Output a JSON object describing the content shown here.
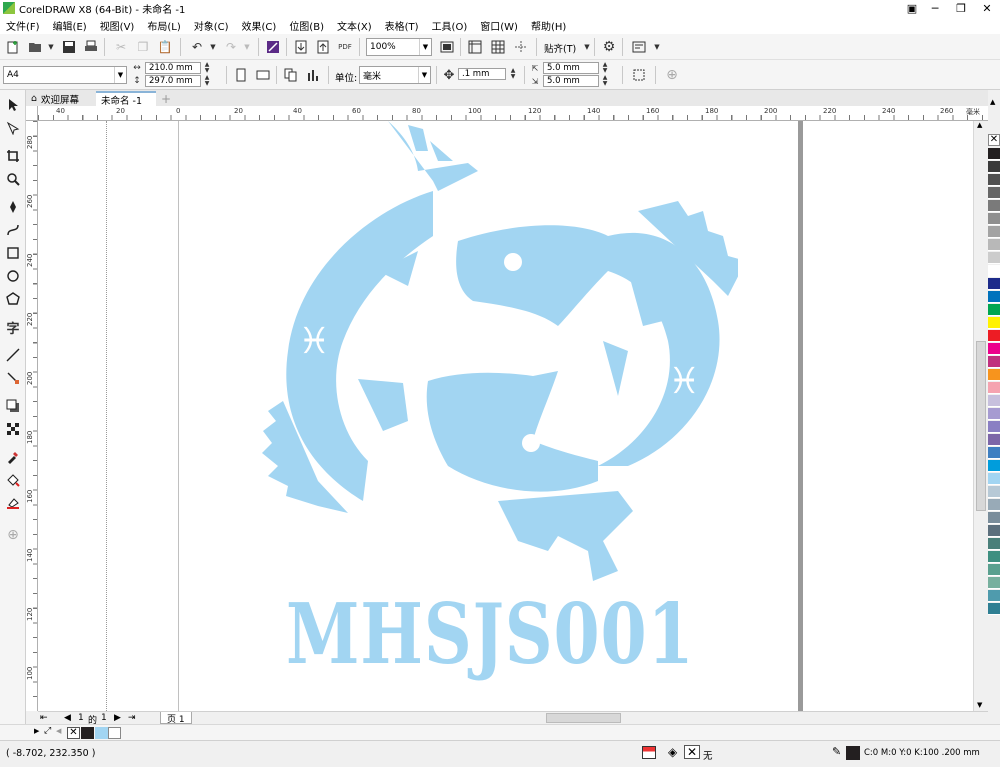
{
  "titlebar": {
    "title": "CorelDRAW X8 (64-Bit) - 未命名 -1"
  },
  "menu": [
    "文件(F)",
    "编辑(E)",
    "视图(V)",
    "布局(L)",
    "对象(C)",
    "效果(C)",
    "位图(B)",
    "文本(X)",
    "表格(T)",
    "工具(O)",
    "窗口(W)",
    "帮助(H)"
  ],
  "toolbar": {
    "zoom": "100%",
    "snap": "贴齐(T)",
    "pdf": "PDF"
  },
  "property_bar": {
    "page_size": "A4",
    "width": "210.0 mm",
    "height": "297.0 mm",
    "units_label": "单位:",
    "units": "毫米",
    "nudge": ".1 mm",
    "dup_x": "5.0 mm",
    "dup_y": "5.0 mm"
  },
  "doc_tabs": {
    "welcome": "欢迎屏幕",
    "document": "未命名 -1"
  },
  "ruler": {
    "unit": "毫米",
    "h_labels": [
      "40",
      "20",
      "0",
      "20",
      "40",
      "60",
      "80",
      "100",
      "120",
      "140",
      "160",
      "180",
      "200",
      "220",
      "240",
      "260"
    ],
    "v_labels": [
      "280",
      "260",
      "240",
      "220",
      "200",
      "180",
      "160",
      "140",
      "120",
      "100"
    ]
  },
  "logo": {
    "text": "MHSJS001",
    "color": "#a2d5f2"
  },
  "page_nav": {
    "current": "1",
    "of": "的",
    "total": "1",
    "tab": "页 1"
  },
  "status": {
    "coords": "( -8.702, 232.350 )",
    "fill": "无",
    "outline": "C:0 M:0 Y:0 K:100  .200 mm"
  },
  "palette_colors": [
    "#231f20",
    "#3a3a3a",
    "#505050",
    "#666666",
    "#7a7a7a",
    "#8f8f8f",
    "#a3a3a3",
    "#b8b8b8",
    "#cccccc",
    "#ffffff",
    "#1d2b8a",
    "#0072bc",
    "#00a651",
    "#fff200",
    "#ed1c24",
    "#ec008c",
    "#c0307f",
    "#f7941d",
    "#f5a3b0",
    "#c7c0dd",
    "#a69bd1",
    "#8a7fc3",
    "#7d66a8",
    "#3e7fc1",
    "#009ddc",
    "#a2d5f2",
    "#b7c9d6",
    "#98aab7",
    "#7a8d9b",
    "#5c6f7d",
    "#4a7f7a",
    "#3e8f80",
    "#5aa08f",
    "#77b09e",
    "#4f9bad",
    "#2f7f93"
  ]
}
